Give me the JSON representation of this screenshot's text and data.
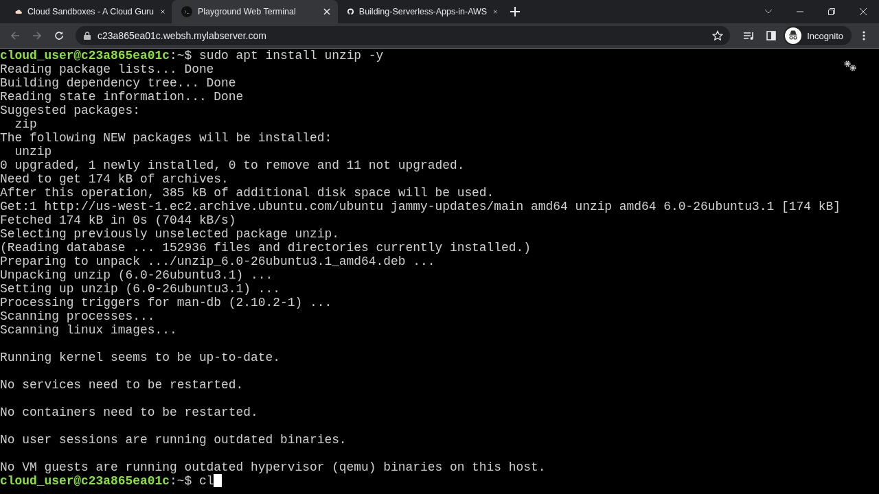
{
  "tabs": [
    {
      "title": "Cloud Sandboxes - A Cloud Guru",
      "kind": "cloud",
      "selected": false
    },
    {
      "title": "Playground Web Terminal",
      "kind": "terminal",
      "selected": true
    },
    {
      "title": "Building-Serverless-Apps-in-AWS",
      "kind": "github",
      "selected": false
    }
  ],
  "address": "c23a865ea01c.websh.mylabserver.com",
  "profile": "Incognito",
  "terminal": {
    "lines": [
      {
        "kind": "prompt",
        "user_host": "cloud_user@c23a865ea01c",
        "path": ":~$",
        "command": "sudo apt install unzip -y",
        "cursor": false
      },
      {
        "kind": "output",
        "text": "Reading package lists... Done"
      },
      {
        "kind": "output",
        "text": "Building dependency tree... Done"
      },
      {
        "kind": "output",
        "text": "Reading state information... Done"
      },
      {
        "kind": "output",
        "text": "Suggested packages:"
      },
      {
        "kind": "output",
        "text": "  zip"
      },
      {
        "kind": "output",
        "text": "The following NEW packages will be installed:"
      },
      {
        "kind": "output",
        "text": "  unzip"
      },
      {
        "kind": "output",
        "text": "0 upgraded, 1 newly installed, 0 to remove and 11 not upgraded."
      },
      {
        "kind": "output",
        "text": "Need to get 174 kB of archives."
      },
      {
        "kind": "output",
        "text": "After this operation, 385 kB of additional disk space will be used."
      },
      {
        "kind": "output",
        "text": "Get:1 http://us-west-1.ec2.archive.ubuntu.com/ubuntu jammy-updates/main amd64 unzip amd64 6.0-26ubuntu3.1 [174 kB]"
      },
      {
        "kind": "output",
        "text": "Fetched 174 kB in 0s (7044 kB/s)"
      },
      {
        "kind": "output",
        "text": "Selecting previously unselected package unzip."
      },
      {
        "kind": "output",
        "text": "(Reading database ... 152936 files and directories currently installed.)"
      },
      {
        "kind": "output",
        "text": "Preparing to unpack .../unzip_6.0-26ubuntu3.1_amd64.deb ..."
      },
      {
        "kind": "output",
        "text": "Unpacking unzip (6.0-26ubuntu3.1) ..."
      },
      {
        "kind": "output",
        "text": "Setting up unzip (6.0-26ubuntu3.1) ..."
      },
      {
        "kind": "output",
        "text": "Processing triggers for man-db (2.10.2-1) ..."
      },
      {
        "kind": "output",
        "text": "Scanning processes..."
      },
      {
        "kind": "output",
        "text": "Scanning linux images..."
      },
      {
        "kind": "blank"
      },
      {
        "kind": "output",
        "text": "Running kernel seems to be up-to-date."
      },
      {
        "kind": "blank"
      },
      {
        "kind": "output",
        "text": "No services need to be restarted."
      },
      {
        "kind": "blank"
      },
      {
        "kind": "output",
        "text": "No containers need to be restarted."
      },
      {
        "kind": "blank"
      },
      {
        "kind": "output",
        "text": "No user sessions are running outdated binaries."
      },
      {
        "kind": "blank"
      },
      {
        "kind": "output",
        "text": "No VM guests are running outdated hypervisor (qemu) binaries on this host."
      },
      {
        "kind": "prompt",
        "user_host": "cloud_user@c23a865ea01c",
        "path": ":~$",
        "command": "cl",
        "cursor": true
      }
    ]
  }
}
